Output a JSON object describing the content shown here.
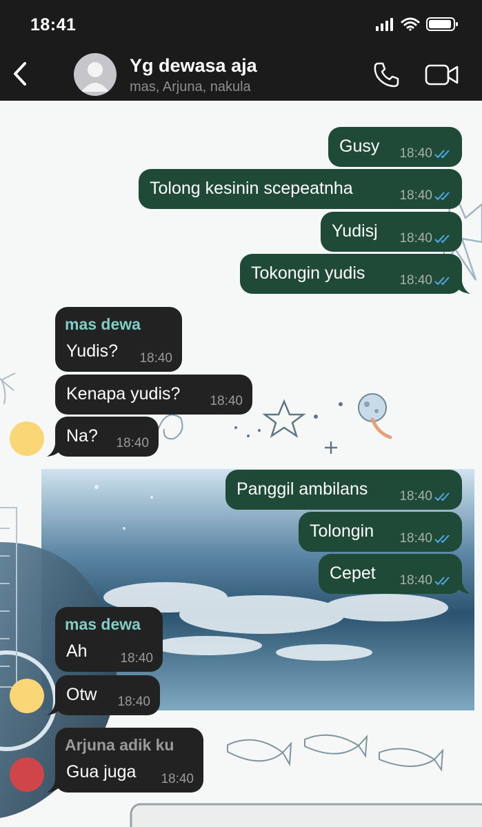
{
  "status_bar": {
    "time": "18:41"
  },
  "header": {
    "title": "Yg dewasa aja",
    "members": "mas, Arjuna, nakula"
  },
  "colors": {
    "outgoing_bubble": "#1f4a37",
    "incoming_bubble": "#222222",
    "mas_dewa_name": "#7ecfc6",
    "arjuna_name": "#9a9a9a",
    "mas_dewa_avatar": "#fbd676",
    "arjuna_avatar": "#d0454a",
    "read_ticks": "#4fa9e6"
  },
  "messages": [
    {
      "dir": "out",
      "text": "Gusy",
      "time": "18:40"
    },
    {
      "dir": "out",
      "text": "Tolong kesinin scepeatnha",
      "time": "18:40"
    },
    {
      "dir": "out",
      "text": "Yudisj",
      "time": "18:40"
    },
    {
      "dir": "out",
      "text": "Tokongin yudis",
      "time": "18:40"
    },
    {
      "dir": "in",
      "sender": "mas dewa",
      "text": "Yudis?",
      "time": "18:40"
    },
    {
      "dir": "in",
      "text": "Kenapa yudis?",
      "time": "18:40"
    },
    {
      "dir": "in",
      "text": "Na?",
      "time": "18:40"
    },
    {
      "dir": "out",
      "text": "Panggil ambilans",
      "time": "18:40"
    },
    {
      "dir": "out",
      "text": "Tolongin",
      "time": "18:40"
    },
    {
      "dir": "out",
      "text": "Cepet",
      "time": "18:40"
    },
    {
      "dir": "in",
      "sender": "mas dewa",
      "text": "Ah",
      "time": "18:40"
    },
    {
      "dir": "in",
      "text": "Otw",
      "time": "18:40"
    },
    {
      "dir": "in",
      "sender": "Arjuna adik ku",
      "text": "Gua juga",
      "time": "18:40"
    }
  ]
}
